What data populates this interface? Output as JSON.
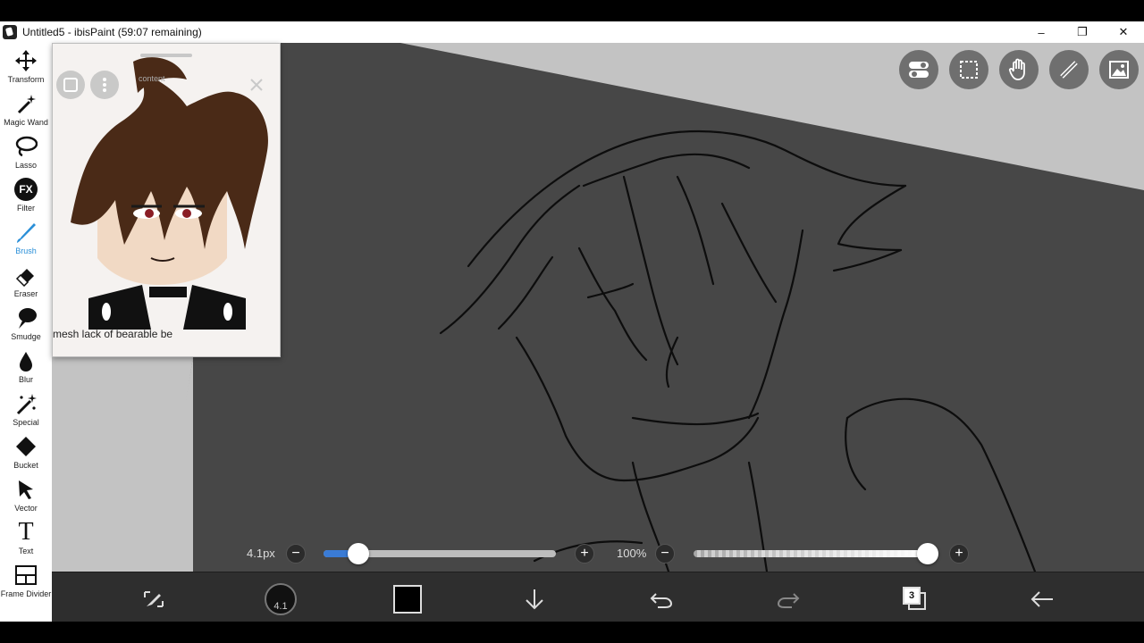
{
  "window": {
    "title": "Untitled5 - ibisPaint (59:07 remaining)",
    "minimize": "–",
    "maximize": "❐",
    "close": "✕"
  },
  "toolbar": {
    "tools": [
      {
        "label": "Transform",
        "icon": "move-icon"
      },
      {
        "label": "Magic Wand",
        "icon": "magic-wand-icon"
      },
      {
        "label": "Lasso",
        "icon": "lasso-icon"
      },
      {
        "label": "Filter",
        "icon": "fx-icon",
        "glyph": "FX"
      },
      {
        "label": "Brush",
        "icon": "brush-icon",
        "active": true
      },
      {
        "label": "Eraser",
        "icon": "eraser-icon"
      },
      {
        "label": "Smudge",
        "icon": "smudge-icon"
      },
      {
        "label": "Blur",
        "icon": "blur-drop-icon"
      },
      {
        "label": "Special",
        "icon": "special-wand-icon"
      },
      {
        "label": "Bucket",
        "icon": "bucket-icon"
      },
      {
        "label": "Vector",
        "icon": "vector-arrow-icon"
      },
      {
        "label": "Text",
        "icon": "text-icon",
        "glyph": "T"
      },
      {
        "label": "Frame Divider",
        "icon": "frame-divider-icon"
      }
    ],
    "accent": "#2a8fd8"
  },
  "reference_window": {
    "content_label": "content",
    "caption": "mesh lack of bearable be"
  },
  "brush_controls": {
    "size_label": "4.1px",
    "size_fraction": 0.15,
    "opacity_label": "100%",
    "opacity_fraction": 1.0,
    "minus": "−",
    "plus": "+"
  },
  "bottom_bar": {
    "brush_size_badge": "4.1",
    "color": "#000000",
    "layer_count": "3"
  },
  "colors": {
    "canvas_gray": "#474747",
    "light_gray_region": "#c3c3c3",
    "bottom_bar": "#2e2e2e"
  }
}
